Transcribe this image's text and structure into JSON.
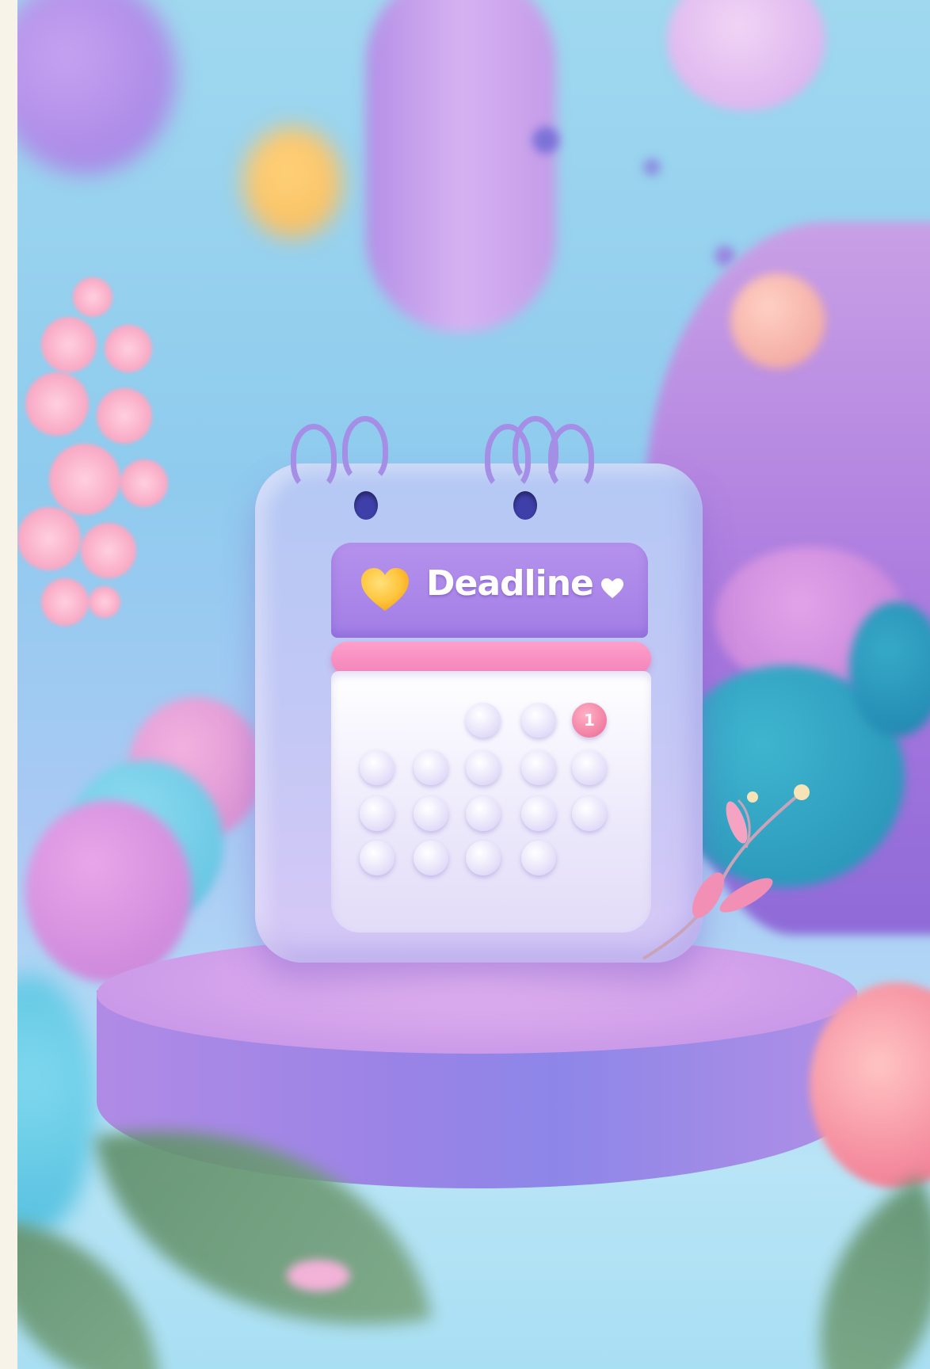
{
  "calendar": {
    "title": "Deadline",
    "marked_day": "1"
  },
  "icons": {
    "primary_heart": "heart-icon",
    "secondary_heart": "small-heart-icon"
  },
  "colors": {
    "header": "#a27ee6",
    "accent_bar": "#f184b9",
    "heart": "#ffc53d",
    "marked_day": "#f07ea0"
  }
}
